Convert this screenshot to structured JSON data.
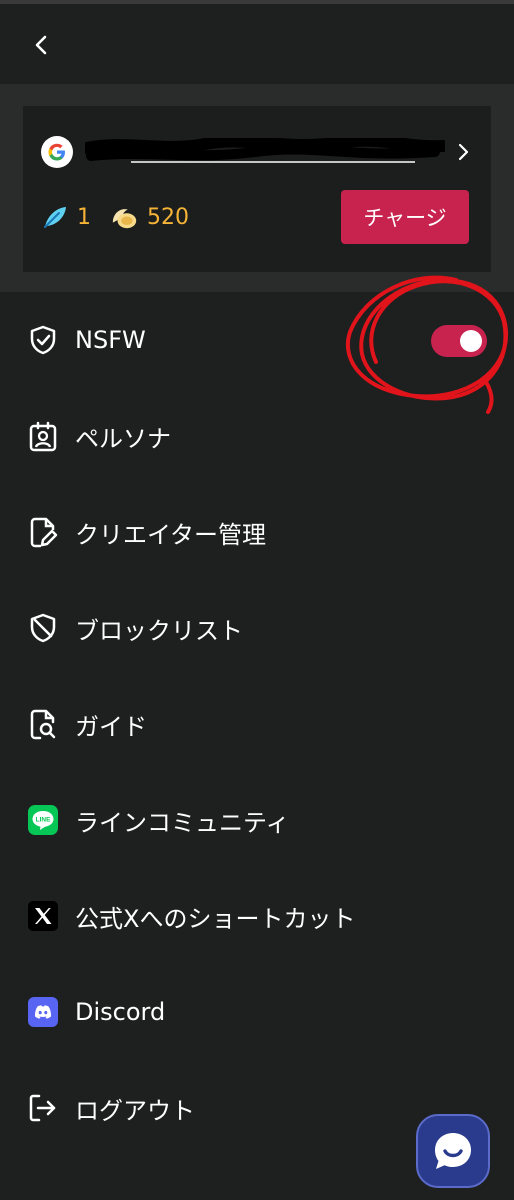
{
  "account": {
    "balance_feather": "1",
    "balance_coin": "520",
    "charge_label": "チャージ"
  },
  "settings": {
    "nsfw_label": "NSFW",
    "nsfw_enabled": true
  },
  "menu": {
    "items": [
      {
        "label": "NSFW",
        "icon": "shield-check-icon"
      },
      {
        "label": "ペルソナ",
        "icon": "persona-badge-icon"
      },
      {
        "label": "クリエイター管理",
        "icon": "file-edit-icon"
      },
      {
        "label": "ブロックリスト",
        "icon": "shield-slash-icon"
      },
      {
        "label": "ガイド",
        "icon": "file-search-icon"
      },
      {
        "label": "ラインコミュニティ",
        "icon": "line-icon"
      },
      {
        "label": "公式Xへのショートカット",
        "icon": "x-logo-icon"
      },
      {
        "label": "Discord",
        "icon": "discord-icon"
      },
      {
        "label": "ログアウト",
        "icon": "logout-icon"
      }
    ]
  },
  "icons": {
    "back": "chevron-left-icon",
    "google": "google-icon",
    "account_arrow": "chevron-right-icon",
    "feather": "feather-icon",
    "coin": "coin-wing-icon",
    "chat": "chat-bubble-icon"
  },
  "colors": {
    "accent": "#c8234f",
    "gold": "#f5b437",
    "background": "#1e1f1f"
  }
}
